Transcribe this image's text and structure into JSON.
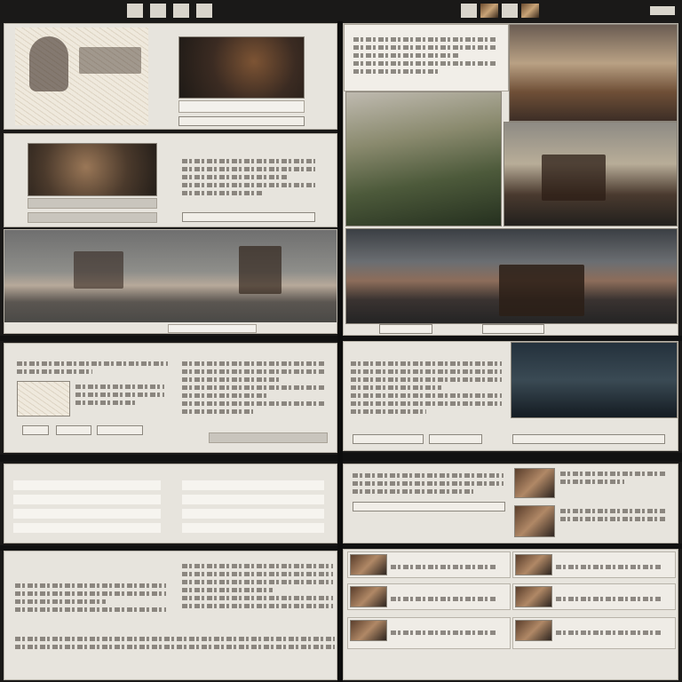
{
  "header": {
    "left_glyphs": [
      "",
      "",
      "",
      ""
    ],
    "right_small": "",
    "right_glyphs": [
      "",
      "",
      ""
    ]
  },
  "icons": {
    "portrait": "portrait-sketch-icon",
    "ship": "ship-illustration-icon",
    "ruin": "ruin-illustration-icon"
  },
  "colors": {
    "background": "#1a1918",
    "panel": "#e7e4dd",
    "border": "#b7b2a8",
    "accent_warm": "#c9a477"
  },
  "panels": {
    "p1": {
      "caption": "",
      "button": ""
    },
    "p2": {
      "title": "",
      "button": ""
    },
    "p4": {
      "title": "",
      "button": ""
    },
    "p5": {
      "button1": "",
      "button2": "",
      "button3": ""
    }
  },
  "list_rows": [
    {
      "title": ""
    },
    {
      "title": ""
    },
    {
      "title": ""
    },
    {
      "title": ""
    },
    {
      "title": ""
    },
    {
      "title": ""
    }
  ]
}
